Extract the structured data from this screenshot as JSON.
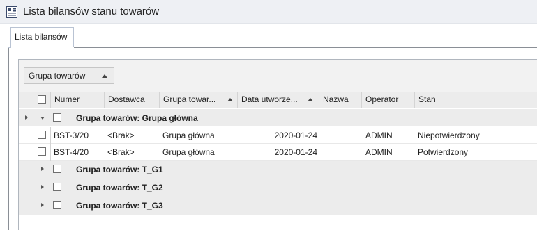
{
  "window": {
    "title": "Lista bilansów stanu towarów",
    "icon": "document-list-icon"
  },
  "tabs": [
    {
      "label": "Lista bilansów",
      "active": true
    }
  ],
  "grouping": {
    "chip_label": "Grupa towarów",
    "sort": "ascending"
  },
  "columns": [
    {
      "label": "Numer"
    },
    {
      "label": "Dostawca"
    },
    {
      "label": "Grupa towar..."
    },
    {
      "label": "Data utworze..."
    },
    {
      "label": "Nazwa"
    },
    {
      "label": "Operator"
    },
    {
      "label": "Stan"
    }
  ],
  "groups": [
    {
      "label": "Grupa towarów: Grupa główna",
      "expanded": true,
      "rows": [
        {
          "numer": "BST-3/20",
          "dostawca": "<Brak>",
          "grupa": "Grupa główna",
          "data": "2020-01-24",
          "nazwa": "",
          "operator": "ADMIN",
          "stan": "Niepotwierdzony"
        },
        {
          "numer": "BST-4/20",
          "dostawca": "<Brak>",
          "grupa": "Grupa główna",
          "data": "2020-01-24",
          "nazwa": "",
          "operator": "ADMIN",
          "stan": "Potwierdzony"
        }
      ]
    },
    {
      "label": "Grupa towarów: T_G1",
      "expanded": false
    },
    {
      "label": "Grupa towarów: T_G2",
      "expanded": false
    },
    {
      "label": "Grupa towarów: T_G3",
      "expanded": false
    }
  ]
}
